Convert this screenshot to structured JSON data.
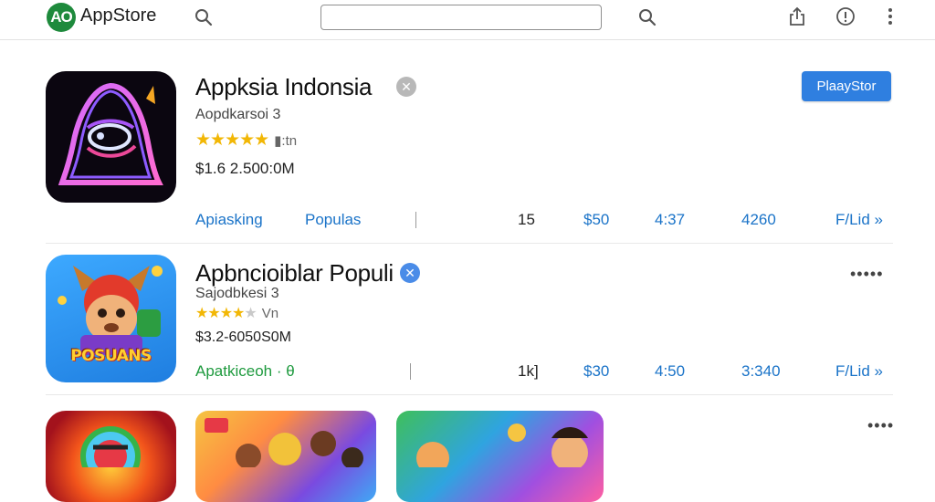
{
  "header": {
    "logo_text": "AO",
    "brand": "AppStore",
    "search_value": "",
    "icons": [
      "search-icon",
      "search-icon",
      "share-icon",
      "info-icon",
      "more-vert-icon"
    ]
  },
  "apps": [
    {
      "title": "Appksia Indonsia",
      "subtitle": "Aopdkarsoi 3",
      "rating_stars": 5,
      "rating_suffix": "▮:tn",
      "price": "$1.6 2.500:0M",
      "action_label": "PlaayStor",
      "stats": [
        "Apiasking",
        "Populas",
        "15",
        "$50",
        "4:37",
        "4260",
        "F/Lid »"
      ]
    },
    {
      "title": "Apbncioiblar Populi",
      "subtitle": "Sajodbkesi 3",
      "rating_stars": 4,
      "rating_suffix": "Vn",
      "price": "$3.2-6050S0M",
      "stats": [
        "Apatkiceoh · θ",
        "1k]",
        "$30",
        "4:50",
        "3:340",
        "F/Lid »"
      ],
      "more_label": "•••••"
    }
  ],
  "third_row": {
    "more_label": "••••"
  },
  "icon_badges": {
    "app2_badge": "POSUANS"
  },
  "colors": {
    "brand_green": "#1e8a3c",
    "accent_blue": "#2f7fe0",
    "link_blue": "#1a73c8",
    "star_gold": "#f2b705"
  }
}
